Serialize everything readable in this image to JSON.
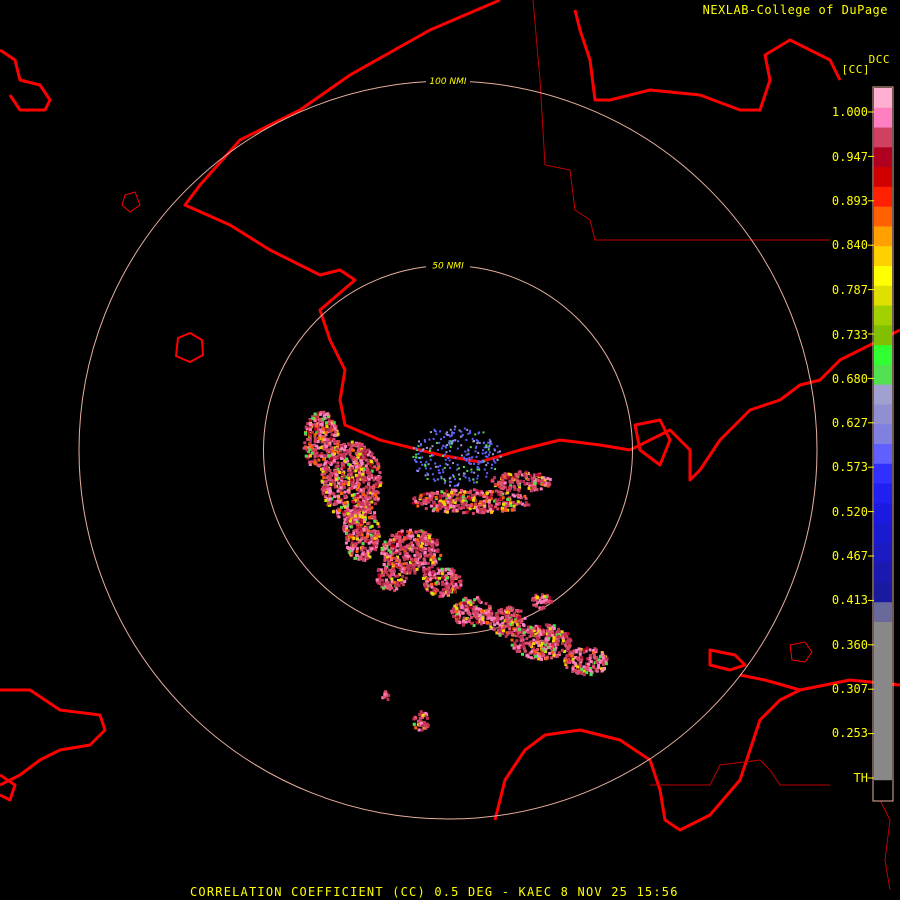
{
  "header": {
    "credit": "NEXLAB-College of DuPage",
    "product_code": "DCC",
    "product_unit": "[CC]"
  },
  "footer": {
    "caption": "CORRELATION COEFFICIENT (CC) 0.5 DEG - KAEC 8 NOV 25 15:56"
  },
  "range_rings": [
    {
      "label": "50 NMI",
      "value": 50
    },
    {
      "label": "100 NMI",
      "value": 100
    }
  ],
  "legend": {
    "ticks": [
      "1.000",
      "0.947",
      "0.893",
      "0.840",
      "0.787",
      "0.733",
      "0.680",
      "0.627",
      "0.573",
      "0.520",
      "0.467",
      "0.413",
      "0.360",
      "0.307",
      "0.253",
      "TH"
    ],
    "colors": [
      "#000000",
      "#888888",
      "#888888",
      "#888888",
      "#888888",
      "#888888",
      "#888888",
      "#888888",
      "#888888",
      "#6a6a9a",
      "#1a1aa0",
      "#1a1ab0",
      "#1a1ac0",
      "#1a1ad0",
      "#1a1ae0",
      "#2020f0",
      "#3030ff",
      "#6060ff",
      "#8080e0",
      "#9090d0",
      "#a0a0d0",
      "#50e050",
      "#30ff30",
      "#80c000",
      "#a0d000",
      "#e0e000",
      "#ffff00",
      "#ffd000",
      "#ffa000",
      "#ff6000",
      "#ff2000",
      "#d00000",
      "#b00020",
      "#d04060",
      "#ff80c0",
      "#ffb0d0"
    ]
  },
  "colors": {
    "coastline": "#ff0000",
    "range_ring": "#e8b0a0",
    "label": "#ffff00"
  }
}
